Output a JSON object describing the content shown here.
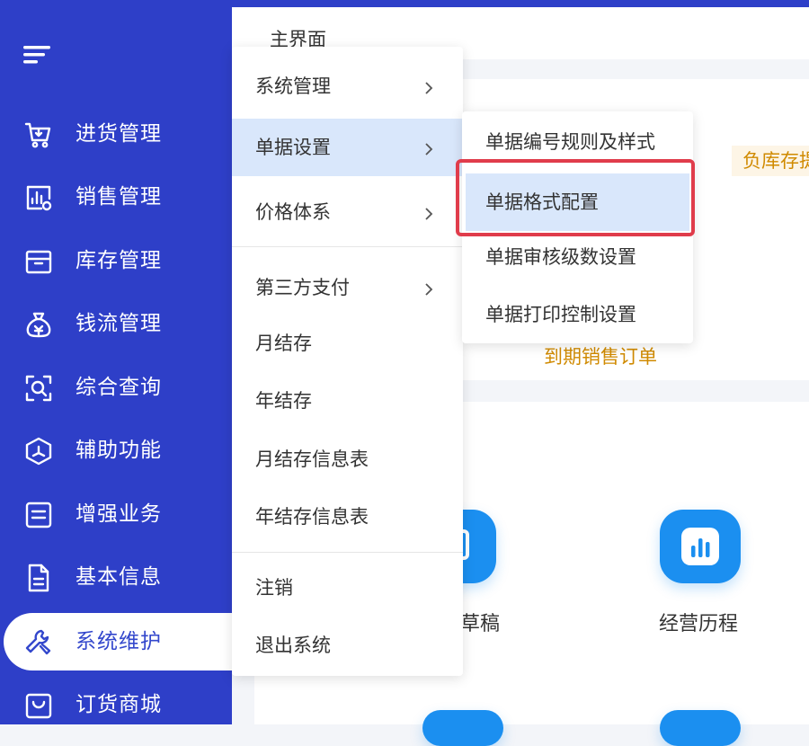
{
  "sidebar": {
    "items": [
      {
        "label": "进货管理",
        "icon": "cart-icon"
      },
      {
        "label": "销售管理",
        "icon": "sales-chart-icon"
      },
      {
        "label": "库存管理",
        "icon": "box-icon"
      },
      {
        "label": "钱流管理",
        "icon": "money-bag-icon"
      },
      {
        "label": "综合查询",
        "icon": "scan-search-icon"
      },
      {
        "label": "辅助功能",
        "icon": "cube-icon"
      },
      {
        "label": "增强业务",
        "icon": "form-icon"
      },
      {
        "label": "基本信息",
        "icon": "document-icon"
      },
      {
        "label": "系统维护",
        "icon": "wrench-icon",
        "active": true
      },
      {
        "label": "订货商城",
        "icon": "bag-icon"
      }
    ]
  },
  "header": {
    "title": "主界面"
  },
  "dashboard": {
    "warning_text": "负库存提",
    "due_link": "到期销售订单",
    "apps": [
      {
        "label": "草稿"
      },
      {
        "label": "经营历程"
      }
    ]
  },
  "menu": {
    "items": [
      {
        "label": "系统管理",
        "has_submenu": true
      },
      {
        "label": "单据设置",
        "has_submenu": true,
        "highlighted": true
      },
      {
        "label": "价格体系",
        "has_submenu": true
      },
      {
        "label": "第三方支付",
        "has_submenu": true
      },
      {
        "label": "月结存"
      },
      {
        "label": "年结存"
      },
      {
        "label": "月结存信息表"
      },
      {
        "label": "年结存信息表"
      },
      {
        "label": "注销"
      },
      {
        "label": "退出系统"
      }
    ]
  },
  "submenu": {
    "items": [
      {
        "label": "单据编号规则及样式"
      },
      {
        "label": "单据格式配置",
        "highlighted": true,
        "annotated": true
      },
      {
        "label": "单据审核级数设置"
      },
      {
        "label": "单据打印控制设置"
      }
    ]
  },
  "colors": {
    "sidebar_bg": "#2e3fc8",
    "highlight": "#d9e7fb",
    "annotation_red": "#e03c4b",
    "warning": "#d08a00",
    "app_blue": "#1b8ff0"
  }
}
